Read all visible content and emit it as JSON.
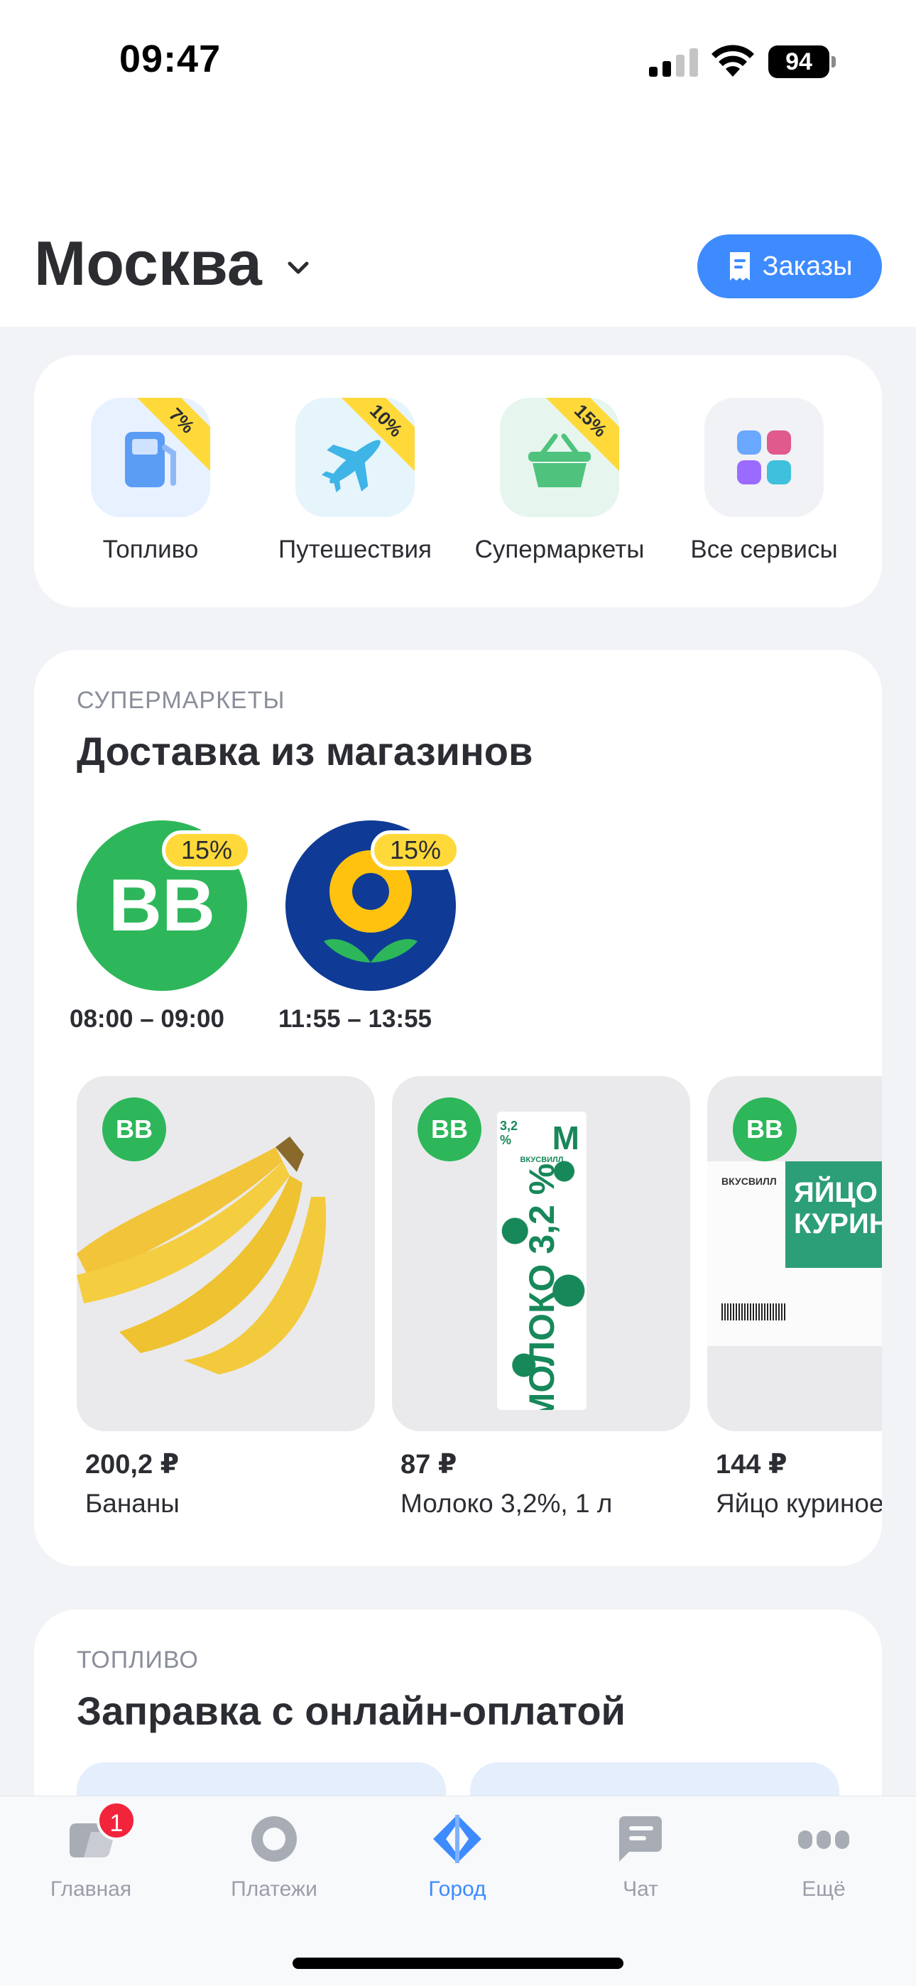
{
  "status_bar": {
    "time": "09:47",
    "battery": "94"
  },
  "header": {
    "city": "Москва",
    "orders_label": "Заказы"
  },
  "services": [
    {
      "label": "Топливо",
      "badge": "7%",
      "icon": "fuel-pump-icon"
    },
    {
      "label": "Путешествия",
      "badge": "10%",
      "icon": "airplane-icon"
    },
    {
      "label": "Супермаркеты",
      "badge": "15%",
      "icon": "basket-icon"
    },
    {
      "label": "Все сервисы",
      "icon": "grid-icon"
    }
  ],
  "supermarkets": {
    "section_label": "СУПЕРМАРКЕТЫ",
    "title": "Доставка из магазинов",
    "stores": [
      {
        "logo_text": "ВВ",
        "badge": "15%",
        "hours": "08:00 – 09:00",
        "color": "#2db75a"
      },
      {
        "badge": "15%",
        "hours": "11:55 – 13:55",
        "color": "#0f3b96"
      }
    ],
    "products": [
      {
        "store": "ВВ",
        "price": "200,2 ₽",
        "name": "Бананы"
      },
      {
        "store": "ВВ",
        "price": "87 ₽",
        "name": "Молоко 3,2%, 1 л",
        "pack": {
          "brand": "ВКУСВИЛЛ",
          "fat_top": "3,2 %",
          "letter": "М",
          "word": "МОЛОКО",
          "fat": "3,2 %"
        }
      },
      {
        "store": "ВВ",
        "price": "144 ₽",
        "name": "Яйцо куриное",
        "pack": {
          "brand": "ВКУСВИЛЛ",
          "line1": "ЯЙЦО",
          "line2": "КУРИНО"
        }
      }
    ]
  },
  "fuel": {
    "section_label": "ТОПЛИВО",
    "title": "Заправка с онлайн-оплатой"
  },
  "tabbar": {
    "items": [
      {
        "label": "Главная",
        "badge": "1"
      },
      {
        "label": "Платежи"
      },
      {
        "label": "Город"
      },
      {
        "label": "Чат"
      },
      {
        "label": "Ещё"
      }
    ]
  },
  "colors": {
    "accent": "#3d8bff",
    "badge_yellow": "#ffd93a",
    "vkusvill_green": "#2db75a",
    "notification_red": "#f2243b"
  }
}
